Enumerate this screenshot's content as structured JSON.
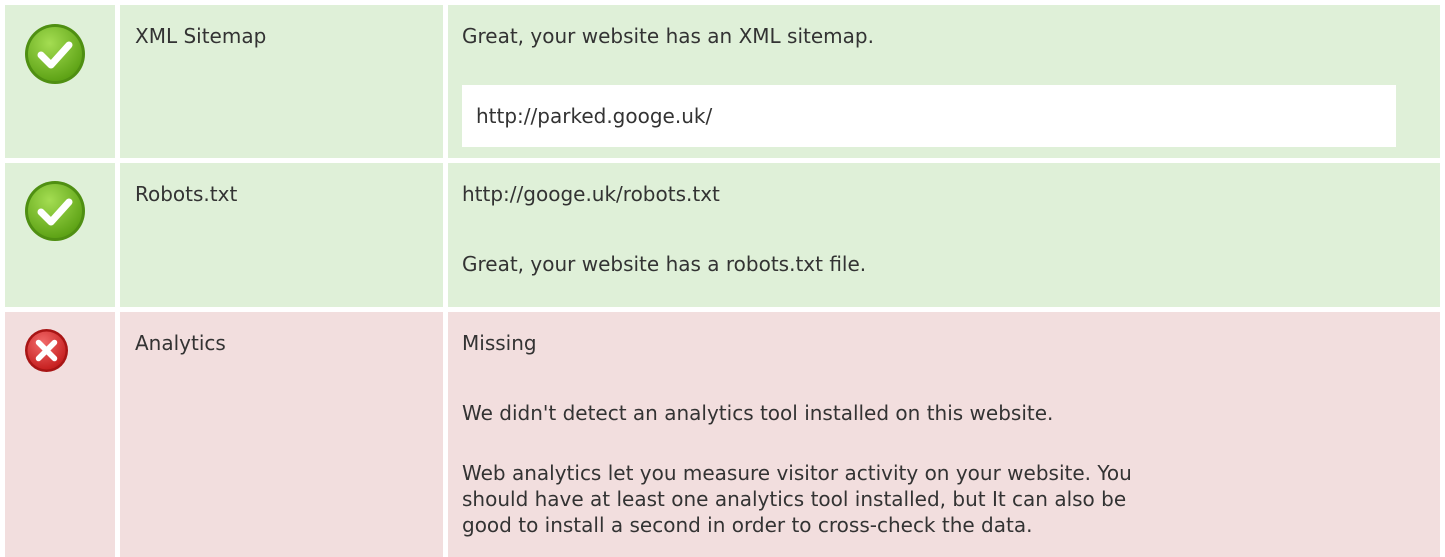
{
  "colors": {
    "ok_bg": "#dff0d8",
    "bad_bg": "#f2dede",
    "ok_icon": "#7cc12d",
    "bad_icon": "#e53935"
  },
  "rows": [
    {
      "status": "ok",
      "icon": "check-icon",
      "name": "XML Sitemap",
      "message": "Great, your website has an XML sitemap.",
      "url": "http://parked.googe.uk/"
    },
    {
      "status": "ok",
      "icon": "check-icon",
      "name": "Robots.txt",
      "url": "http://googe.uk/robots.txt",
      "message": "Great, your website has a robots.txt file."
    },
    {
      "status": "bad",
      "icon": "cross-icon",
      "name": "Analytics",
      "value": "Missing",
      "message": "We didn't detect an analytics tool installed on this website.",
      "description_lines": [
        "Web analytics let you measure visitor activity on your website. You",
        "should have at least one analytics tool installed, but It can also be",
        "good to install a second in order to cross-check the data."
      ]
    }
  ]
}
